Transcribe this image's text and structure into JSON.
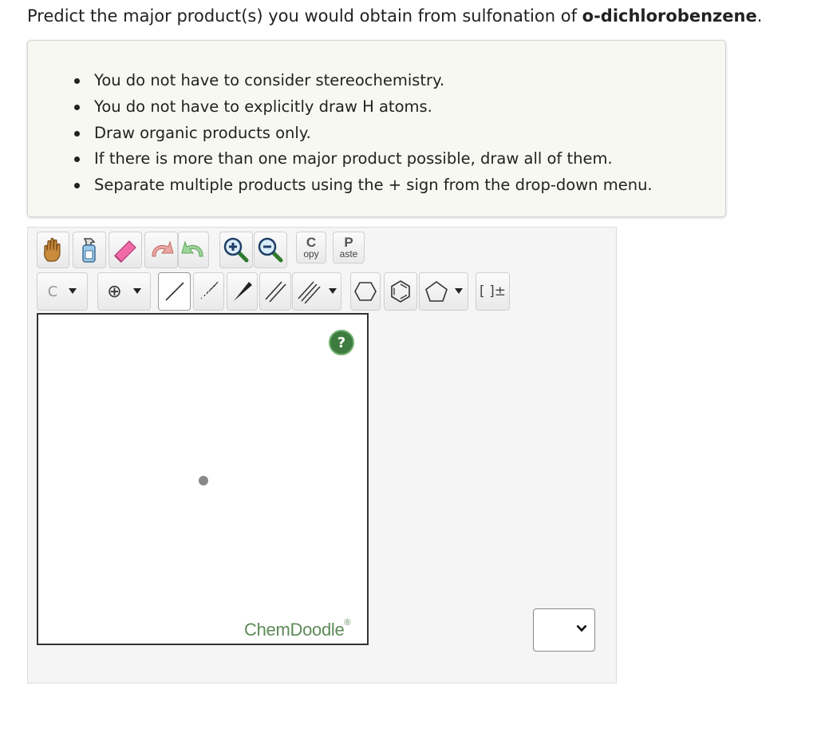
{
  "question": {
    "prefix": "Predict the major product(s) you would obtain from sulfonation of ",
    "compound": "o-dichlorobenzene",
    "suffix": "."
  },
  "instructions": [
    "You do not have to consider stereochemistry.",
    "You do not have to explicitly draw H atoms.",
    "Draw organic products only.",
    "If there is more than one major product possible, draw all of them.",
    "Separate multiple products using the + sign from the drop-down menu."
  ],
  "toolbar": {
    "copy_big": "C",
    "copy_small": "opy",
    "paste_big": "P",
    "paste_small": "aste",
    "atom_label": "C",
    "charge_label": "⊕",
    "bracket_label": "[ ]±"
  },
  "canvas": {
    "help_label": "?",
    "brand": "ChemDoodle",
    "brand_mark": "®"
  },
  "answer_select": {
    "selected": ""
  }
}
